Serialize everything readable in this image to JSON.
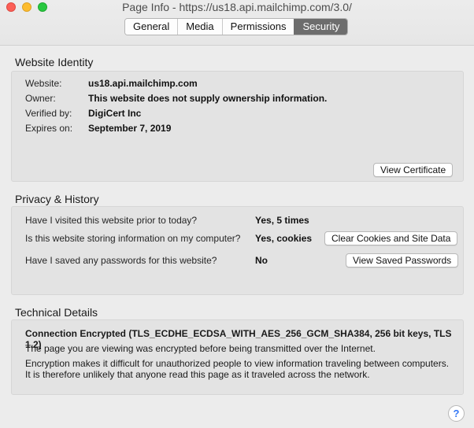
{
  "window": {
    "title": "Page Info - https://us18.api.mailchimp.com/3.0/",
    "tabs": [
      "General",
      "Media",
      "Permissions",
      "Security"
    ],
    "active_tab": "Security"
  },
  "identity": {
    "title": "Website Identity",
    "website_label": "Website:",
    "website_value": "us18.api.mailchimp.com",
    "owner_label": "Owner:",
    "owner_value": "This website does not supply ownership information.",
    "verified_label": "Verified by:",
    "verified_value": "DigiCert Inc",
    "expires_label": "Expires on:",
    "expires_value": "September 7, 2019",
    "view_cert_button": "View Certificate"
  },
  "privacy": {
    "title": "Privacy & History",
    "q1": "Have I visited this website prior to today?",
    "a1": "Yes, 5 times",
    "q2": "Is this website storing information on my computer?",
    "a2": "Yes, cookies",
    "clear_button": "Clear Cookies and Site Data",
    "q3": "Have I saved any passwords for this website?",
    "a3": "No",
    "passwords_button": "View Saved Passwords"
  },
  "technical": {
    "title": "Technical Details",
    "heading": "Connection Encrypted (TLS_ECDHE_ECDSA_WITH_AES_256_GCM_SHA384, 256 bit keys, TLS 1.2)",
    "line1": "The page you are viewing was encrypted before being transmitted over the Internet.",
    "line2": "Encryption makes it difficult for unauthorized people to view information traveling between computers.",
    "line3": "It is therefore unlikely that anyone read this page as it traveled across the network."
  },
  "help": {
    "label": "?"
  },
  "icons": [
    "close-light-icon",
    "minimize-light-icon",
    "zoom-light-icon",
    "help-icon"
  ]
}
